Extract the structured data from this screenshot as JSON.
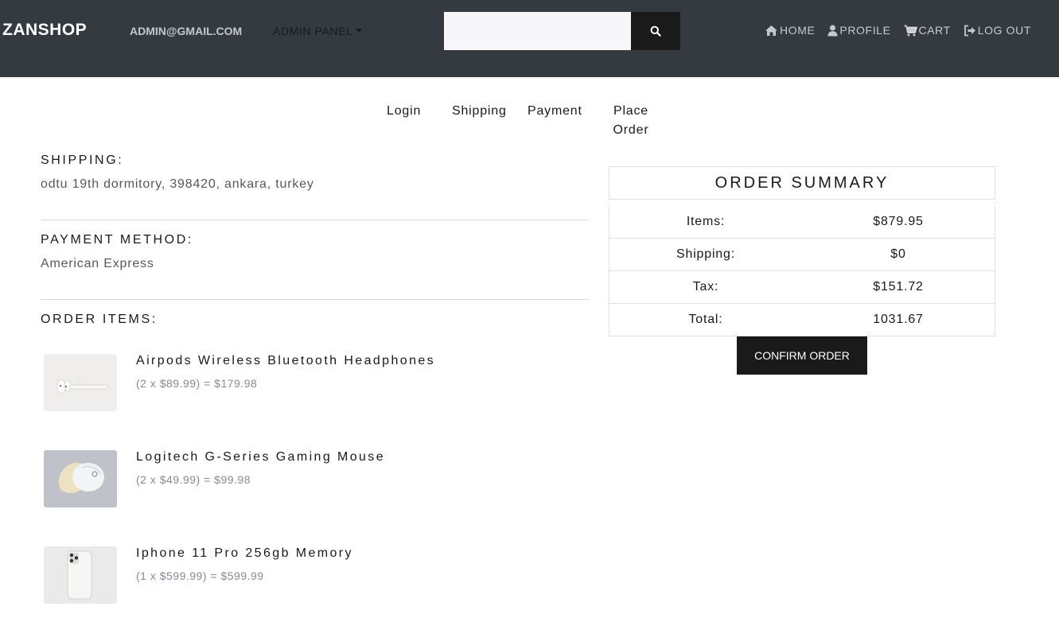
{
  "navbar": {
    "brand": "ZANSHOP",
    "user_email": "ADMIN@GMAIL.COM",
    "admin_panel": "ADMIN PANEL",
    "search": {
      "value": "",
      "placeholder": ""
    },
    "links": [
      {
        "label": "HOME",
        "icon": "home-icon"
      },
      {
        "label": "PROFILE",
        "icon": "user-icon"
      },
      {
        "label": "CART",
        "icon": "cart-icon"
      },
      {
        "label": "LOG OUT",
        "icon": "logout-icon"
      }
    ]
  },
  "steps": {
    "login": "Login",
    "shipping": "Shipping",
    "payment": "Payment",
    "place_order_line1": "Place",
    "place_order_line2": "Order"
  },
  "shipping": {
    "heading": "SHIPPING:",
    "address": "odtu 19th dormitory, 398420, ankara, turkey"
  },
  "payment": {
    "heading": "PAYMENT METHOD:",
    "method": "American Express"
  },
  "order_items": {
    "heading": "ORDER ITEMS:",
    "items": [
      {
        "name": "Airpods Wireless Bluetooth Headphones",
        "price_line": "(2 x $89.99) = $179.98",
        "image": "airpods-image"
      },
      {
        "name": "Logitech G-Series Gaming Mouse",
        "price_line": "(2 x $49.99) = $99.98",
        "image": "mouse-image"
      },
      {
        "name": "Iphone 11 Pro 256gb Memory",
        "price_line": "(1 x $599.99) = $599.99",
        "image": "iphone-image"
      }
    ]
  },
  "summary": {
    "title": "ORDER SUMMARY",
    "rows": [
      {
        "label": "Items:",
        "value": "$879.95"
      },
      {
        "label": "Shipping:",
        "value": "$0"
      },
      {
        "label": "Tax:",
        "value": "$151.72"
      },
      {
        "label": "Total:",
        "value": "1031.67"
      }
    ],
    "confirm_label": "CONFIRM ORDER"
  },
  "colors": {
    "navbar_bg": "#343a40",
    "button_bg": "#1a1a1a"
  }
}
